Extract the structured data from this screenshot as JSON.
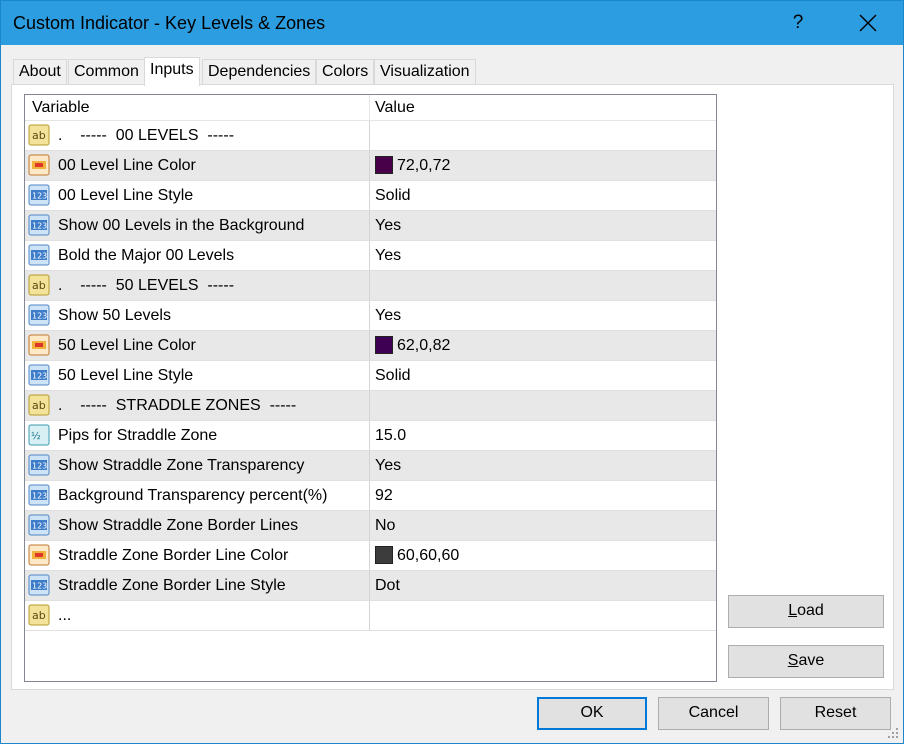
{
  "window": {
    "title": "Custom Indicator - Key Levels & Zones",
    "help_label": "?",
    "title_bar_color": "#2b9de0"
  },
  "tabs": [
    {
      "label": "About",
      "active": false
    },
    {
      "label": "Common",
      "active": false
    },
    {
      "label": "Inputs",
      "active": true
    },
    {
      "label": "Dependencies",
      "active": false
    },
    {
      "label": "Colors",
      "active": false
    },
    {
      "label": "Visualization",
      "active": false
    }
  ],
  "grid": {
    "headers": {
      "variable": "Variable",
      "value": "Value"
    },
    "rows": [
      {
        "icon": "ab-icon",
        "variable": ".    -----  00 LEVELS  -----",
        "value": ""
      },
      {
        "icon": "color-icon",
        "variable": "00 Level Line Color",
        "value": "72,0,72",
        "swatch": "#480048"
      },
      {
        "icon": "123-icon",
        "variable": "00 Level Line Style",
        "value": "Solid"
      },
      {
        "icon": "123-icon",
        "variable": "Show 00 Levels in the Background",
        "value": "Yes"
      },
      {
        "icon": "123-icon",
        "variable": "Bold the Major 00 Levels",
        "value": "Yes"
      },
      {
        "icon": "ab-icon",
        "variable": ".    -----  50 LEVELS  -----",
        "value": ""
      },
      {
        "icon": "123-icon",
        "variable": "Show 50 Levels",
        "value": "Yes"
      },
      {
        "icon": "color-icon",
        "variable": "50 Level Line Color",
        "value": "62,0,82",
        "swatch": "#3e0052"
      },
      {
        "icon": "123-icon",
        "variable": "50 Level Line Style",
        "value": "Solid"
      },
      {
        "icon": "ab-icon",
        "variable": ".    -----  STRADDLE ZONES  -----",
        "value": ""
      },
      {
        "icon": "half-icon",
        "variable": "Pips for Straddle Zone",
        "value": "15.0"
      },
      {
        "icon": "123-icon",
        "variable": "Show Straddle Zone Transparency",
        "value": "Yes"
      },
      {
        "icon": "123-icon",
        "variable": "Background Transparency percent(%)",
        "value": "92"
      },
      {
        "icon": "123-icon",
        "variable": "Show Straddle Zone Border Lines",
        "value": "No"
      },
      {
        "icon": "color-icon",
        "variable": "Straddle Zone Border Line Color",
        "value": "60,60,60",
        "swatch": "#3c3c3c"
      },
      {
        "icon": "123-icon",
        "variable": "Straddle Zone Border Line Style",
        "value": "Dot"
      },
      {
        "icon": "ab-icon",
        "variable": "...",
        "value": ""
      }
    ]
  },
  "buttons": {
    "load_prefix": "",
    "load_underlined": "L",
    "load_rest": "oad",
    "save_underlined": "S",
    "save_rest": "ave",
    "ok": "OK",
    "cancel": "Cancel",
    "reset": "Reset"
  }
}
